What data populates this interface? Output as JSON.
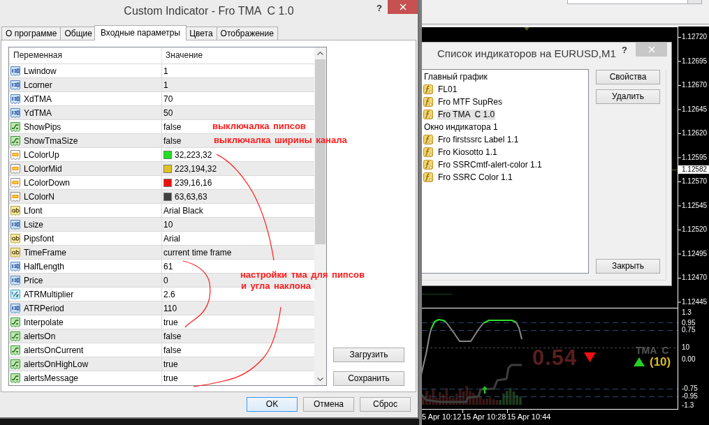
{
  "dialog": {
    "title": "Custom Indicator - Fro TMA  C 1.0",
    "help": "?",
    "tabs": [
      {
        "label": "О программе",
        "selected": false
      },
      {
        "label": "Общие",
        "selected": false
      },
      {
        "label": "Входные параметры",
        "selected": true
      },
      {
        "label": "Цвета",
        "selected": false
      },
      {
        "label": "Отображение",
        "selected": false
      }
    ],
    "table": {
      "columns": [
        "Переменная",
        "Значение"
      ],
      "rows": [
        {
          "kind": "int",
          "name": "Lwindow",
          "value": "1"
        },
        {
          "kind": "int",
          "name": "Lcorner",
          "value": "1"
        },
        {
          "kind": "int",
          "name": "XdTMA",
          "value": "70"
        },
        {
          "kind": "int",
          "name": "YdTMA",
          "value": "50"
        },
        {
          "kind": "bool",
          "name": "ShowPips",
          "value": "false"
        },
        {
          "kind": "bool",
          "name": "ShowTmaSize",
          "value": "false"
        },
        {
          "kind": "color",
          "name": "LColorUp",
          "value": "32,223,32",
          "color": "#20df20"
        },
        {
          "kind": "color",
          "name": "LColorMid",
          "value": "223,194,32",
          "color": "#dfc220"
        },
        {
          "kind": "color",
          "name": "LColorDown",
          "value": "239,16,16",
          "color": "#ef1010"
        },
        {
          "kind": "color",
          "name": "LColorN",
          "value": "63,63,63",
          "color": "#3f3f3f"
        },
        {
          "kind": "string",
          "name": "Lfont",
          "value": "Arial Black"
        },
        {
          "kind": "int",
          "name": "Lsize",
          "value": "10"
        },
        {
          "kind": "string",
          "name": "Pipsfont",
          "value": "Arial"
        },
        {
          "kind": "string",
          "name": "TimeFrame",
          "value": "current time frame"
        },
        {
          "kind": "int",
          "name": "HalfLength",
          "value": "61"
        },
        {
          "kind": "int",
          "name": "Price",
          "value": "0"
        },
        {
          "kind": "double",
          "name": "ATRMultiplier",
          "value": "2.6"
        },
        {
          "kind": "int",
          "name": "ATRPeriod",
          "value": "110"
        },
        {
          "kind": "bool",
          "name": "Interpolate",
          "value": "true"
        },
        {
          "kind": "bool",
          "name": "alertsOn",
          "value": "false"
        },
        {
          "kind": "bool",
          "name": "alertsOnCurrent",
          "value": "false"
        },
        {
          "kind": "bool",
          "name": "alertsOnHighLow",
          "value": "true"
        },
        {
          "kind": "bool",
          "name": "alertsMessage",
          "value": "true"
        }
      ]
    },
    "side_buttons": [
      "Загрузить",
      "Сохранить"
    ],
    "buttons": [
      {
        "label": "OK",
        "default": true
      },
      {
        "label": "Отмена",
        "default": false
      },
      {
        "label": "Сброс",
        "default": false
      }
    ]
  },
  "annotations": [
    "выключалка пипсов",
    "выключалка ширины канала",
    "настройки тма для пипсов",
    "и угла наклона"
  ],
  "terminal": {
    "indicator_list": {
      "title": "Список индикаторов на EURUSD,M1",
      "help": "?",
      "groups": [
        {
          "label": "Главный график",
          "selected": false,
          "children": [
            {
              "label": "FL01",
              "selected": false
            },
            {
              "label": "Fro MTF SupRes",
              "selected": false
            },
            {
              "label": "Fro TMA  C 1.0",
              "selected": true
            }
          ]
        },
        {
          "label": "Окно индикатора 1",
          "selected": false,
          "children": [
            {
              "label": "Fro firstssrc Label 1.1",
              "selected": false
            },
            {
              "label": "Fro Kiosotto 1.1",
              "selected": false
            },
            {
              "label": "Fro SSRCmtf-alert-color 1.1",
              "selected": false
            },
            {
              "label": "Fro SSRC Color 1.1",
              "selected": false
            }
          ]
        }
      ],
      "buttons": [
        "Свойства",
        "Удалить"
      ],
      "close_label": "Закрыть"
    },
    "price_axis": {
      "labels": [
        "1.12720",
        "1.12695",
        "1.12670",
        "1.12645",
        "1.12620",
        "1.12595",
        "1.12570",
        "1.12545",
        "1.12520",
        "1.12495",
        "1.12470",
        "1.12445"
      ],
      "current": "1.12582"
    },
    "subwindow": {
      "axis_labels": [
        "1.3",
        "0.95",
        "0.75",
        "10",
        "0.00",
        "-0.75",
        "-0.95",
        "-1.3"
      ],
      "value": "0.54",
      "title": "TMA  C",
      "period": "(10)"
    },
    "time_axis": [
      "5 Apr 10:12",
      "15 Apr 10:28",
      "15 Apr 10:44"
    ]
  }
}
